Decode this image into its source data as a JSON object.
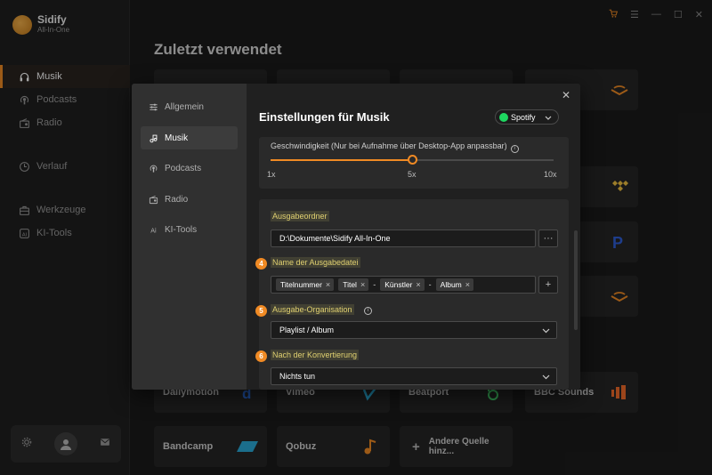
{
  "app": {
    "name": "Sidify",
    "subtitle": "All-In-One"
  },
  "titlebar": {
    "cart_icon": "cart-icon",
    "menu_icon": "menu-icon",
    "minimize_icon": "minimize-icon",
    "maximize_icon": "maximize-icon",
    "close_icon": "close-icon"
  },
  "sidebar": {
    "items": [
      {
        "label": "Musik",
        "icon": "headphones-icon",
        "active": true
      },
      {
        "label": "Podcasts",
        "icon": "podcast-icon"
      },
      {
        "label": "Radio",
        "icon": "radio-icon"
      },
      {
        "label": "Verlauf",
        "icon": "clock-icon"
      },
      {
        "label": "Werkzeuge",
        "icon": "toolbox-icon"
      },
      {
        "label": "KI-Tools",
        "icon": "ai-icon"
      }
    ]
  },
  "main": {
    "title": "Zuletzt verwendet",
    "tiles": [
      {
        "label": "Dailymotion"
      },
      {
        "label": "Vimeo"
      },
      {
        "label": "Beatport"
      },
      {
        "label": "BBC Sounds"
      },
      {
        "label": "Bandcamp"
      },
      {
        "label": "Qobuz"
      },
      {
        "label": "Andere Quelle hinz..."
      }
    ]
  },
  "settings": {
    "nav": [
      {
        "label": "Allgemein",
        "icon": "sliders-icon"
      },
      {
        "label": "Musik",
        "icon": "music-note-icon",
        "active": true
      },
      {
        "label": "Podcasts",
        "icon": "podcast-icon"
      },
      {
        "label": "Radio",
        "icon": "radio-icon"
      },
      {
        "label": "KI-Tools",
        "icon": "ai-icon"
      }
    ],
    "title": "Einstellungen für Musik",
    "source": {
      "label": "Spotify",
      "color": "#1ed760"
    },
    "speed": {
      "label": "Geschwindigkeit (Nur bei Aufnahme über Desktop-App anpassbar)",
      "ticks": [
        "1x",
        "5x",
        "10x"
      ],
      "value": 5,
      "min": 1,
      "max": 10
    },
    "output_folder": {
      "label": "Ausgabeordner",
      "value": "D:\\Dokumente\\Sidify All-In-One",
      "browse_label": "···"
    },
    "filename": {
      "badge": "4",
      "label": "Name der Ausgabedatei",
      "chips": [
        "Titelnummer",
        "Titel",
        "Künstler",
        "Album"
      ],
      "separator": "-",
      "add_label": "+"
    },
    "organisation": {
      "badge": "5",
      "label": "Ausgabe-Organisation",
      "value": "Playlist  /  Album"
    },
    "after_conversion": {
      "badge": "6",
      "label": "Nach der Konvertierung",
      "value": "Nichts tun"
    }
  },
  "colors": {
    "accent": "#f08a24",
    "highlight": "#e0d070",
    "background": "#1b1b1b"
  }
}
